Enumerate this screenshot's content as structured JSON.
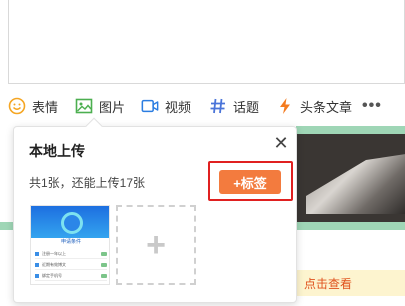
{
  "toolbar": {
    "emoji_label": "表情",
    "image_label": "图片",
    "video_label": "视频",
    "topic_label": "话题",
    "article_label": "头条文章",
    "more_label": "•••"
  },
  "popup": {
    "title": "本地上传",
    "close": "✕",
    "count_text": "共1张，还能上传17张",
    "tag_button": "+标签",
    "add_symbol": "+"
  },
  "thumbnail": {
    "subtitle": "申请条件",
    "rows": [
      "注册一年以上",
      "近期有效博文",
      "绑定手机号"
    ]
  },
  "feed": {
    "notice_link": "点击查看"
  },
  "colors": {
    "accent_orange": "#f37b3e",
    "highlight_red": "#e02020",
    "emoji_yellow": "#f5a623",
    "image_green": "#4caf50",
    "video_blue": "#2b7de1",
    "topic_blue": "#4a74d9",
    "article_orange": "#f47b20"
  }
}
